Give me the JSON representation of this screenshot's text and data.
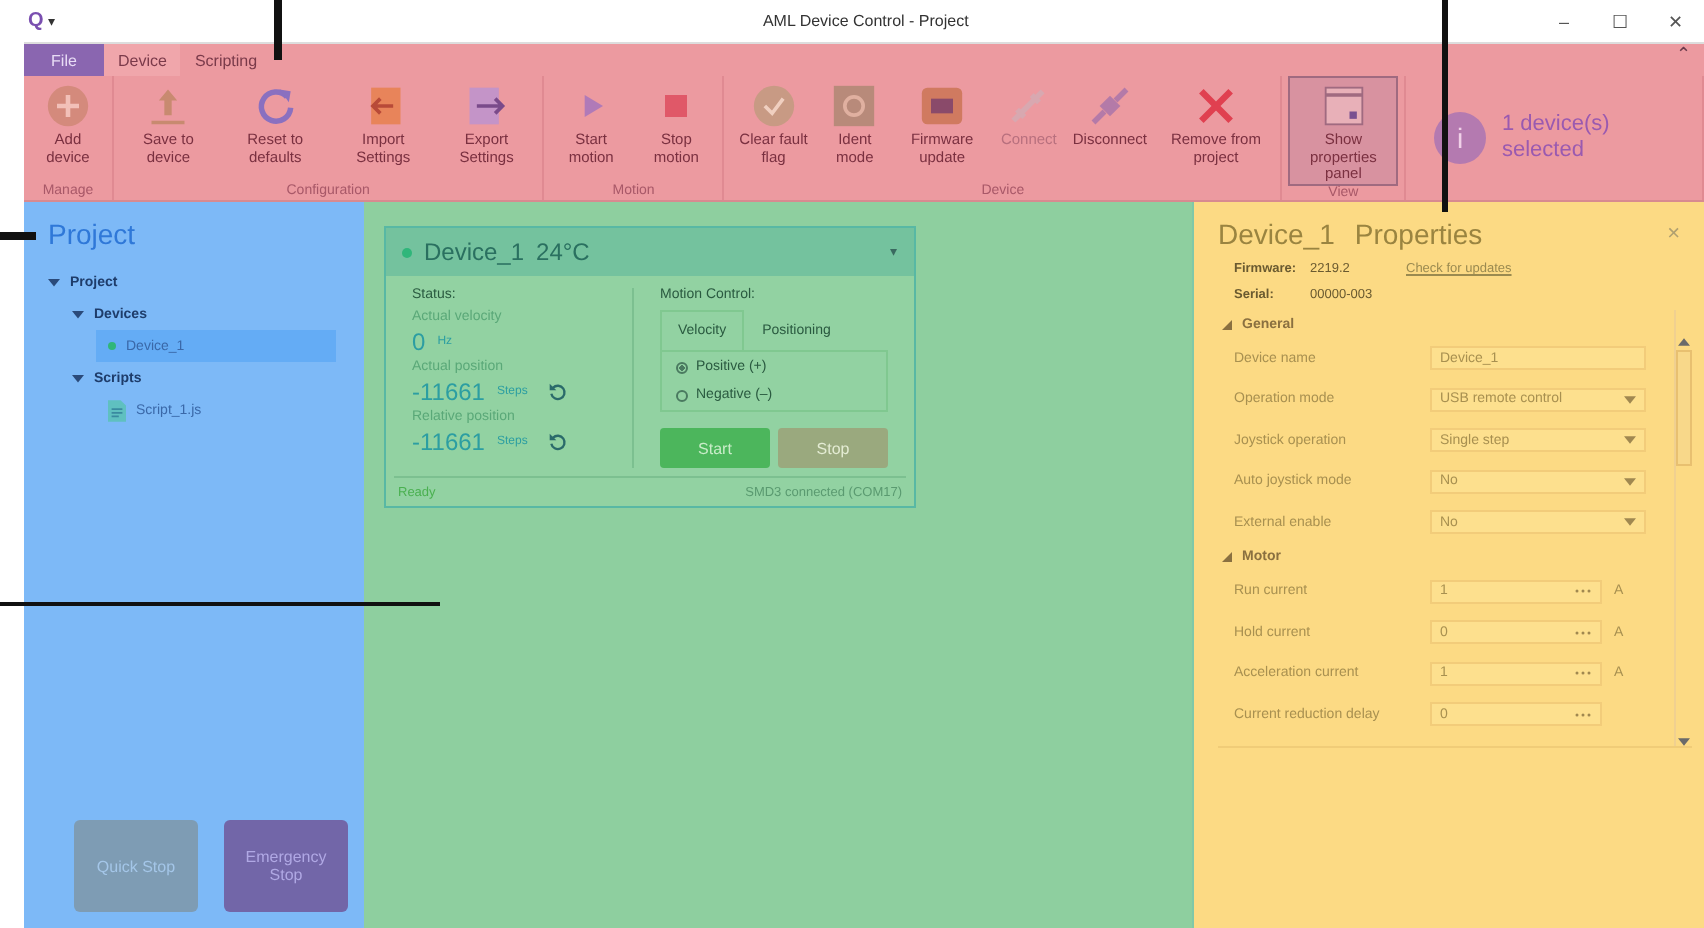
{
  "window": {
    "logo": "Q",
    "menu_caret": "▾",
    "title": "AML Device Control - Project",
    "controls": [
      "–",
      "☐",
      "✕"
    ]
  },
  "ribbon_tabs": [
    {
      "label": "File",
      "kind": "file",
      "selected": false
    },
    {
      "label": "Device",
      "kind": "tab",
      "selected": true
    },
    {
      "label": "Scripting",
      "kind": "tab",
      "selected": false
    }
  ],
  "collapse_caret": "⌃",
  "ribbon_groups": [
    {
      "label": "Manage",
      "buttons": [
        {
          "label": "Add device",
          "kind": "plus",
          "disabled": false,
          "selected": false
        }
      ]
    },
    {
      "label": "Configuration",
      "buttons": [
        {
          "label": "Save to device",
          "kind": "upload",
          "disabled": false,
          "selected": false
        },
        {
          "label": "Reset to defaults",
          "kind": "reset",
          "disabled": false,
          "selected": false
        },
        {
          "label": "Import Settings",
          "kind": "import",
          "disabled": false,
          "selected": false
        },
        {
          "label": "Export Settings",
          "kind": "export",
          "disabled": false,
          "selected": false
        }
      ]
    },
    {
      "label": "Motion",
      "buttons": [
        {
          "label": "Start motion",
          "kind": "play",
          "disabled": false,
          "selected": false
        },
        {
          "label": "Stop motion",
          "kind": "stop",
          "disabled": false,
          "selected": false
        }
      ]
    },
    {
      "label": "Device",
      "buttons": [
        {
          "label": "Clear fault flag",
          "kind": "check",
          "disabled": false,
          "selected": false
        },
        {
          "label": "Ident mode",
          "kind": "target",
          "disabled": false,
          "selected": false
        },
        {
          "label": "Firmware update",
          "kind": "chip",
          "disabled": false,
          "selected": false
        },
        {
          "label": "Connect",
          "kind": "plug",
          "disabled": true,
          "selected": false
        },
        {
          "label": "Disconnect",
          "kind": "unplug",
          "disabled": false,
          "selected": false
        },
        {
          "label": "Remove from project",
          "kind": "x",
          "disabled": false,
          "selected": false
        }
      ]
    },
    {
      "label": "View",
      "buttons": [
        {
          "label": "Show properties panel",
          "kind": "panel",
          "disabled": false,
          "selected": true
        }
      ]
    }
  ],
  "selection_info": {
    "icon_text": "i",
    "text": "1 device(s) selected"
  },
  "project_panel": {
    "title": "Project",
    "tree": [
      {
        "label": "Project",
        "kind": "folder",
        "expanded": true,
        "children": [
          {
            "label": "Devices",
            "kind": "folder",
            "expanded": true,
            "children": [
              {
                "label": "Device_1",
                "kind": "device",
                "selected": true,
                "color": "#2fb67a"
              }
            ]
          },
          {
            "label": "Scripts",
            "kind": "folder",
            "expanded": true,
            "children": [
              {
                "label": "Script_1.js",
                "kind": "script",
                "selected": false
              }
            ]
          }
        ]
      }
    ],
    "buttons": [
      {
        "label": "Quick Stop",
        "kind": "quick"
      },
      {
        "label": "Emergency Stop",
        "kind": "emergency"
      }
    ]
  },
  "device_card": {
    "name": "Device_1",
    "temperature": "24°C",
    "caret": "▾",
    "status_label": "Status:",
    "readings": [
      {
        "label": "Actual velocity",
        "value": "0",
        "unit": "Hz",
        "resettable": false
      },
      {
        "label": "Actual position",
        "value": "-11661",
        "unit": "Steps",
        "resettable": true
      },
      {
        "label": "Relative position",
        "value": "-11661",
        "unit": "Steps",
        "resettable": true
      }
    ],
    "motion_label": "Motion Control:",
    "motion_tabs": [
      {
        "label": "Velocity",
        "selected": true
      },
      {
        "label": "Positioning",
        "selected": false
      }
    ],
    "directions": [
      {
        "label": "Positive (+)",
        "selected": true
      },
      {
        "label": "Negative (–)",
        "selected": false
      }
    ],
    "buttons": [
      {
        "label": "Start",
        "disabled": false
      },
      {
        "label": "Stop",
        "disabled": true
      }
    ],
    "state": "Ready",
    "connection": "SMD3 connected (COM17)"
  },
  "properties_panel": {
    "device": "Device_1",
    "title": "Properties",
    "close": "×",
    "firmware_label": "Firmware:",
    "firmware": "2219.2",
    "update_link": "Check for updates",
    "serial_label": "Serial:",
    "serial": "00000-003",
    "sections": [
      {
        "label": "General",
        "expanded": true,
        "rows": [
          {
            "label": "Device name",
            "value": "Device_1",
            "kind": "text"
          },
          {
            "label": "Operation mode",
            "value": "USB remote control",
            "kind": "select"
          },
          {
            "label": "Joystick operation",
            "value": "Single step",
            "kind": "select"
          },
          {
            "label": "Auto joystick mode",
            "value": "No",
            "kind": "select"
          },
          {
            "label": "External enable",
            "value": "No",
            "kind": "select"
          }
        ]
      },
      {
        "label": "Motor",
        "expanded": true,
        "rows": [
          {
            "label": "Run current",
            "value": "1",
            "kind": "number",
            "unit": "A"
          },
          {
            "label": "Hold current",
            "value": "0",
            "kind": "number",
            "unit": "A"
          },
          {
            "label": "Acceleration current",
            "value": "1",
            "kind": "number",
            "unit": "A"
          },
          {
            "label": "Current reduction delay",
            "value": "0",
            "kind": "number"
          }
        ]
      }
    ]
  }
}
